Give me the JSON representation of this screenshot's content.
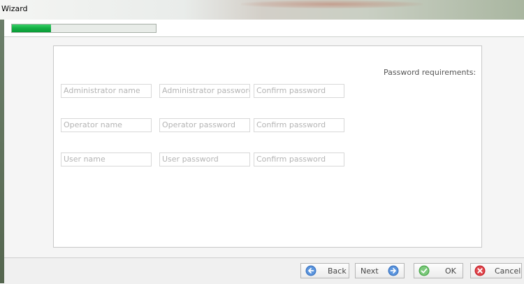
{
  "window": {
    "title": "Wizard"
  },
  "progress": {
    "fraction": 0.27
  },
  "password_requirements_label": "Password requirements:",
  "fields": {
    "admin_name": "Administrator name",
    "admin_password": "Administrator password",
    "admin_confirm": "Confirm password",
    "operator_name": "Operator name",
    "operator_password": "Operator password",
    "operator_confirm": "Confirm password",
    "user_name": "User name",
    "user_password": "User password",
    "user_confirm": "Confirm password"
  },
  "buttons": {
    "back": "Back",
    "next": "Next",
    "ok": "OK",
    "cancel": "Cancel"
  },
  "colors": {
    "progress": "#16b247",
    "nav_icon": "#3e76c2",
    "ok_icon": "#5cb85c",
    "cancel_icon": "#d9323a"
  },
  "icons": {
    "back": "arrow-left-circle-icon",
    "next": "arrow-right-circle-icon",
    "ok": "check-circle-icon",
    "cancel": "x-circle-icon"
  }
}
